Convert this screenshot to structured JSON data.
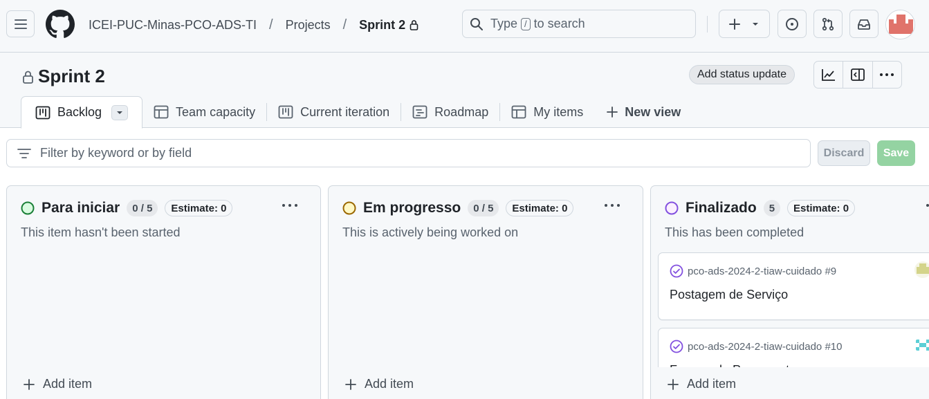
{
  "header": {
    "org": "ICEI-PUC-Minas-PCO-ADS-TI",
    "section": "Projects",
    "project": "Sprint 2",
    "search": {
      "prefix": "Type",
      "key": "/",
      "suffix": "to search"
    },
    "icons": [
      "hamburger-icon",
      "github-logo",
      "plus-icon",
      "triangle-down-icon",
      "issue-opened-icon",
      "git-pull-request-icon",
      "inbox-icon",
      "user-avatar"
    ]
  },
  "project": {
    "title": "Sprint 2",
    "status_button": "Add status update",
    "toolbar_icons": [
      "graph-icon",
      "sidebar-icon",
      "kebab-icon"
    ]
  },
  "tabs": [
    {
      "label": "Backlog",
      "icon": "board-icon",
      "active": true
    },
    {
      "label": "Team capacity",
      "icon": "table-icon"
    },
    {
      "label": "Current iteration",
      "icon": "board-icon"
    },
    {
      "label": "Roadmap",
      "icon": "roadmap-icon"
    },
    {
      "label": "My items",
      "icon": "table-icon"
    },
    {
      "label": "New view",
      "icon": "plus-icon"
    }
  ],
  "filter": {
    "placeholder": "Filter by keyword or by field",
    "discard": "Discard",
    "save": "Save"
  },
  "columns": [
    {
      "title": "Para iniciar",
      "count": "0 / 5",
      "estimate": "Estimate: 0",
      "description": "This item hasn't been started",
      "status_color": "#1a7f37",
      "status_fill": "#dafbe1",
      "add_label": "Add item",
      "cards": []
    },
    {
      "title": "Em progresso",
      "count": "0 / 5",
      "estimate": "Estimate: 0",
      "description": "This is actively being worked on",
      "status_color": "#9a6700",
      "status_fill": "#fff8c5",
      "add_label": "Add item",
      "cards": []
    },
    {
      "title": "Finalizado",
      "count": "5",
      "estimate": "Estimate: 0",
      "description": "This has been completed",
      "status_color": "#8250df",
      "status_fill": "#fbefff",
      "add_label": "Add item",
      "cards": [
        {
          "ref": "pco-ads-2024-2-tiaw-cuidado #9",
          "title": "Postagem de Serviço",
          "avatar_color": "#d4d48a"
        },
        {
          "ref": "pco-ads-2024-2-tiaw-cuidado #10",
          "title": "Formas de Pagamento",
          "avatar_color": "#5ccfd6"
        }
      ]
    }
  ],
  "colors": {
    "accent": "#0969da",
    "save_disabled": "#94d3a2",
    "done_purple": "#8250df",
    "avatar": "#e0736b"
  }
}
